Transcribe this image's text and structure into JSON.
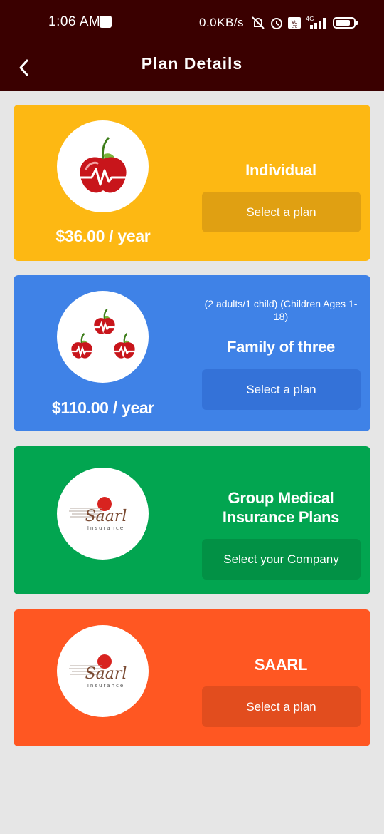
{
  "status_bar": {
    "time": "1:06 AM",
    "network_speed": "0.0KB/s",
    "network_type": "4G+",
    "volte": "Vo LTE"
  },
  "header": {
    "title": "Plan Details",
    "back_icon": "chevron-left-icon"
  },
  "plans": [
    {
      "id": "individual",
      "name": "Individual",
      "price": "$36.00 / year",
      "button_label": "Select a plan",
      "bg_color": "#fdb813",
      "button_color": "#e0a012",
      "logo": "cherry-heartbeat-icon"
    },
    {
      "id": "family",
      "note": "(2 adults/1 child)  (Children Ages 1-18)",
      "name": "Family of three",
      "price": "$110.00 / year",
      "button_label": "Select a plan",
      "bg_color": "#3f82e7",
      "button_color": "#3472d8",
      "logo": "three-cherries-heartbeat-icon"
    },
    {
      "id": "group",
      "name": "Group Medical Insurance Plans",
      "button_label": "Select your Company",
      "bg_color": "#02a550",
      "button_color": "#029145",
      "logo": "saarl-insurance-logo",
      "logo_text": "Saarl",
      "logo_subtext": "Insurance"
    },
    {
      "id": "saarl",
      "name": "SAARL",
      "button_label": "Select a plan",
      "bg_color": "#ff5722",
      "button_color": "#e24d1e",
      "logo": "saarl-insurance-logo",
      "logo_text": "Saarl",
      "logo_subtext": "Insurance"
    }
  ]
}
